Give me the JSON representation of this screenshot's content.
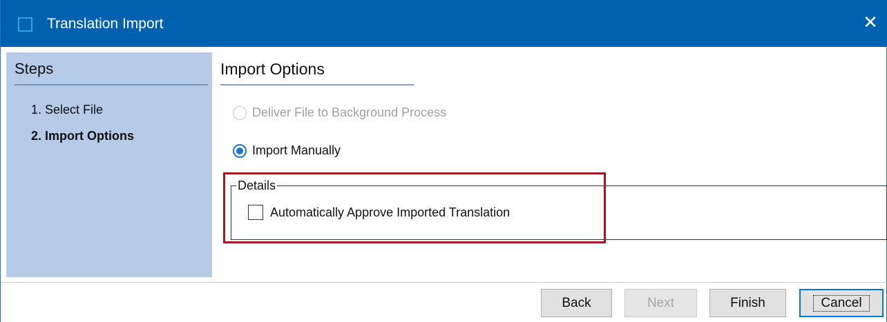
{
  "window": {
    "title": "Translation Import",
    "close_glyph": "✕",
    "colors": {
      "titlebar": "#0061b0",
      "steps_panel": "#b5cbe8",
      "highlight": "#a11a22",
      "radio_accent": "#1a73d9"
    }
  },
  "steps": {
    "header": "Steps",
    "items": [
      {
        "label": "1. Select File",
        "current": false
      },
      {
        "label": "2. Import Options",
        "current": true
      }
    ]
  },
  "main": {
    "title": "Import Options",
    "options": [
      {
        "label": "Deliver File to Background Process",
        "selected": false,
        "enabled": false
      },
      {
        "label": "Import Manually",
        "selected": true,
        "enabled": true
      }
    ],
    "details": {
      "legend": "Details",
      "checkbox_label": "Automatically Approve Imported Translation",
      "checked": false
    }
  },
  "footer": {
    "back": "Back",
    "next": "Next",
    "finish": "Finish",
    "cancel": "Cancel",
    "next_enabled": false
  },
  "icons": {
    "app": "window-square-icon",
    "close": "close-icon"
  }
}
